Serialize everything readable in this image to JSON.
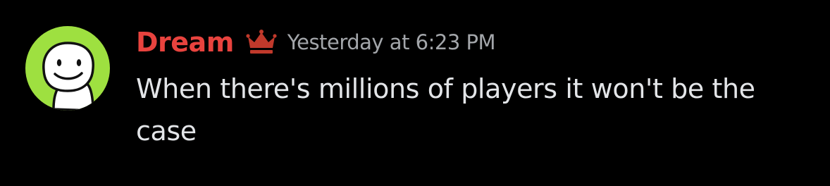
{
  "message": {
    "author": "Dream",
    "author_color": "#e8433e",
    "badge_icon": "crown-icon",
    "badge_color": "#c0392b",
    "timestamp": "Yesterday at 6:23 PM",
    "content": "When there's millions of players it won't be the case",
    "avatar": {
      "icon": "smiley-mask-avatar",
      "background": "#9ee040"
    }
  }
}
